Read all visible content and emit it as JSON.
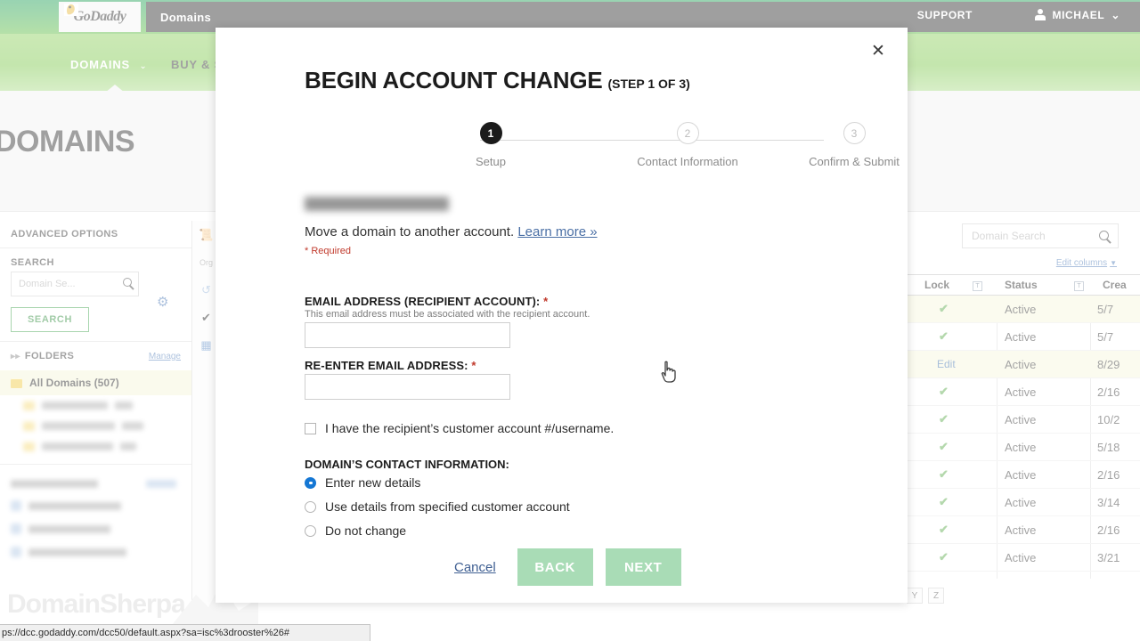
{
  "browser": {
    "status_url": "ps://dcc.godaddy.com/dcc50/default.aspx?sa=isc%3drooster%26#"
  },
  "background": {
    "brand": "GoDaddy",
    "brand_icon": "godaddy-hat-logo",
    "active_tab": "Domains",
    "support_label": "SUPPORT",
    "user_name": "MICHAEL",
    "user_caret": "⌄",
    "nav": [
      {
        "label": "DOMAINS",
        "caret": "⌄"
      },
      {
        "label": "BUY & S",
        "caret": ""
      }
    ],
    "page_title": "DOMAINS",
    "watermark": "DomainSherpa",
    "sidebar": {
      "advanced_options": "ADVANCED OPTIONS",
      "search_label": "SEARCH",
      "search_placeholder": "Domain Se...",
      "search_button": "SEARCH",
      "gear_icon": "gear-icon",
      "folders_label": "FOLDERS",
      "manage_label": "Manage",
      "all_domains": "All Domains (507)",
      "blurred_folder_count": 3,
      "blurred_link_count": 3
    },
    "table": {
      "search_placeholder": "Domain Search",
      "edit_columns": "Edit columns",
      "columns": [
        "Lock",
        "Status",
        "Crea"
      ],
      "rows": [
        {
          "lock": "✔",
          "lock_type": "check",
          "status": "Active",
          "created": "5/7"
        },
        {
          "lock": "✔",
          "lock_type": "check",
          "status": "Active",
          "created": "5/7"
        },
        {
          "lock": "Edit",
          "lock_type": "link",
          "status": "Active",
          "created": "8/29"
        },
        {
          "lock": "✔",
          "lock_type": "check",
          "status": "Active",
          "created": "2/16"
        },
        {
          "lock": "✔",
          "lock_type": "check",
          "status": "Active",
          "created": "10/2"
        },
        {
          "lock": "✔",
          "lock_type": "check",
          "status": "Active",
          "created": "5/18"
        },
        {
          "lock": "✔",
          "lock_type": "check",
          "status": "Active",
          "created": "2/16"
        },
        {
          "lock": "✔",
          "lock_type": "check",
          "status": "Active",
          "created": "3/14"
        },
        {
          "lock": "✔",
          "lock_type": "check",
          "status": "Active",
          "created": "2/16"
        },
        {
          "lock": "✔",
          "lock_type": "check",
          "status": "Active",
          "created": "3/21"
        }
      ],
      "alpha_buttons": [
        "Y",
        "Z"
      ]
    }
  },
  "modal": {
    "title": "BEGIN ACCOUNT CHANGE",
    "step_of": "(STEP 1 OF 3)",
    "close_icon": "close-icon",
    "steps": [
      {
        "num": "1",
        "caption": "Setup",
        "state": "active"
      },
      {
        "num": "2",
        "caption": "Contact Information",
        "state": "idle"
      },
      {
        "num": "3",
        "caption": "Confirm & Submit",
        "state": "idle"
      }
    ],
    "intro_text": "Move a domain to another account.",
    "learn_more": "Learn more »",
    "required_note": "* Required",
    "fields": {
      "email_label": "EMAIL ADDRESS (RECIPIENT ACCOUNT):",
      "email_help": "This email address must be associated with the recipient account.",
      "email_value": "",
      "email_placeholder": "",
      "reemail_label": "RE-ENTER EMAIL ADDRESS:",
      "reemail_value": "",
      "reemail_placeholder": "",
      "asterisk": "*"
    },
    "checkbox": {
      "label": "I have the recipient’s customer account #/username.",
      "checked": false
    },
    "contact_header": "DOMAIN’S CONTACT INFORMATION:",
    "contact_options": [
      {
        "label": "Enter new details",
        "selected": true
      },
      {
        "label": "Use details from specified customer account",
        "selected": false
      },
      {
        "label": "Do not change",
        "selected": false
      }
    ],
    "buttons": {
      "cancel": "Cancel",
      "back": "BACK",
      "next": "NEXT"
    }
  },
  "colors": {
    "brand_green_dark": "#1d9e54",
    "brand_green_light": "#7cc74b",
    "button_green": "#a9dcb6",
    "radio_blue": "#1577d4",
    "required_red": "#c0392b",
    "link_blue": "#4a6fa5",
    "step_active": "#1b1b1b"
  }
}
